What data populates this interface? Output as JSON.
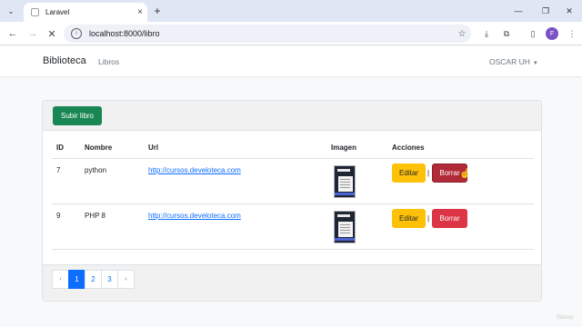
{
  "browser": {
    "tab_title": "Laravel",
    "address": "localhost:8000/libro",
    "profile_initial": "F"
  },
  "navbar": {
    "brand": "Biblioteca",
    "link": "Libros",
    "user": "OSCAR UH"
  },
  "card": {
    "upload_button": "Subir libro"
  },
  "table": {
    "headers": [
      "ID",
      "Nombre",
      "Url",
      "Imagen",
      "Acciones"
    ],
    "rows": [
      {
        "id": "7",
        "nombre": "python",
        "url": "http://cursos.develoteca.com",
        "edit": "Editar",
        "sep": "|",
        "delete": "Borrar"
      },
      {
        "id": "9",
        "nombre": "PHP 8",
        "url": "http://cursos.develoteca.com",
        "edit": "Editar",
        "sep": "|",
        "delete": "Borrar"
      }
    ]
  },
  "pagination": {
    "prev": "‹",
    "pages": [
      "1",
      "2",
      "3"
    ],
    "active_page": "1",
    "next": "›"
  },
  "watermark": "Sitemp"
}
